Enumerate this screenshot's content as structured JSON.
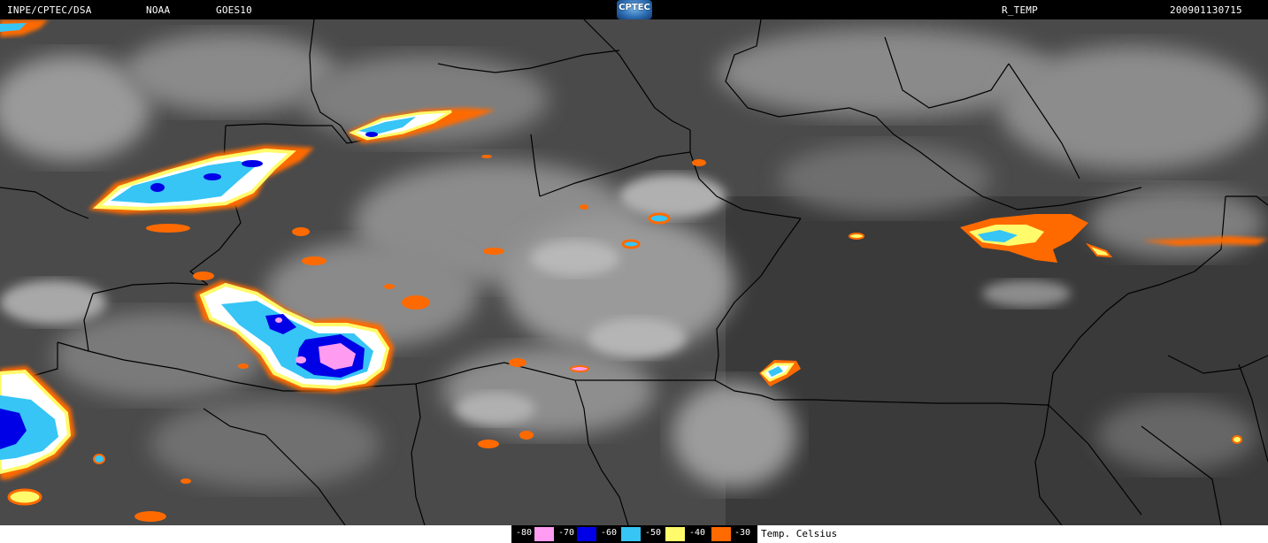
{
  "header": {
    "source": "INPE/CPTEC/DSA",
    "agency": "NOAA",
    "satellite": "GOES10",
    "logo": "CPTEC",
    "product": "R_TEMP",
    "timestamp": "200901130715"
  },
  "legend": {
    "unit": "Temp. Celsius",
    "items": [
      {
        "label": "-80",
        "color": "#ff9cf2"
      },
      {
        "label": "-70",
        "color": "#0000e6"
      },
      {
        "label": "-60",
        "color": "#36c5f5"
      },
      {
        "label": "-50",
        "color": "#fffb6b"
      },
      {
        "label": "-40",
        "color": "#ff6a00"
      },
      {
        "label": "-30",
        "color": "#ffffff"
      }
    ]
  },
  "colors": {
    "background": "#000000",
    "cloud_gray": "#9a9a9a",
    "ground_dark": "#3f3f3f",
    "border_line": "#000000",
    "legend_bar": "#ffffff"
  }
}
